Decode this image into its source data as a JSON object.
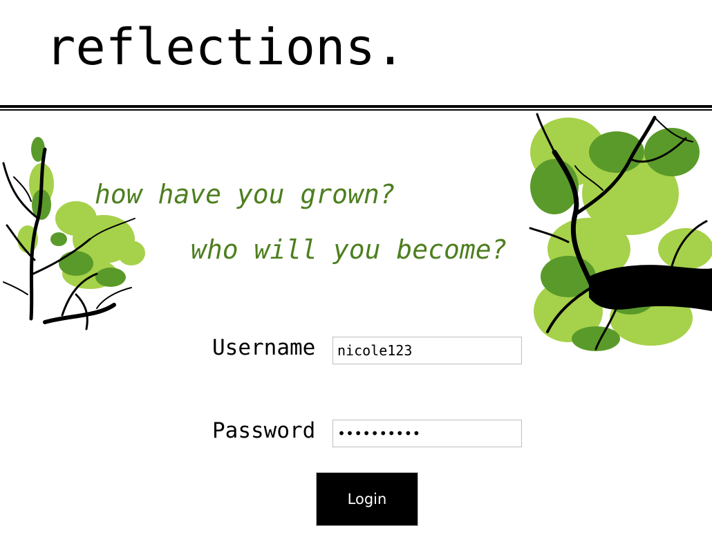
{
  "header": {
    "title": "reflections."
  },
  "tagline": {
    "line1": "how have you grown?",
    "line2": "who will you become?"
  },
  "login_form": {
    "username_label": "Username",
    "username_value": "nicole123",
    "password_label": "Password",
    "password_value": "••••••••••",
    "login_label": "Login"
  },
  "colors": {
    "tagline": "#4d7f1f",
    "leaf_dark": "#5a9a2a",
    "leaf_light": "#a6d14a",
    "branches": "#000000",
    "button_bg": "#000000"
  },
  "decorations": {
    "left_image": "tree-branches-illustration",
    "right_image": "tree-canopy-illustration"
  }
}
